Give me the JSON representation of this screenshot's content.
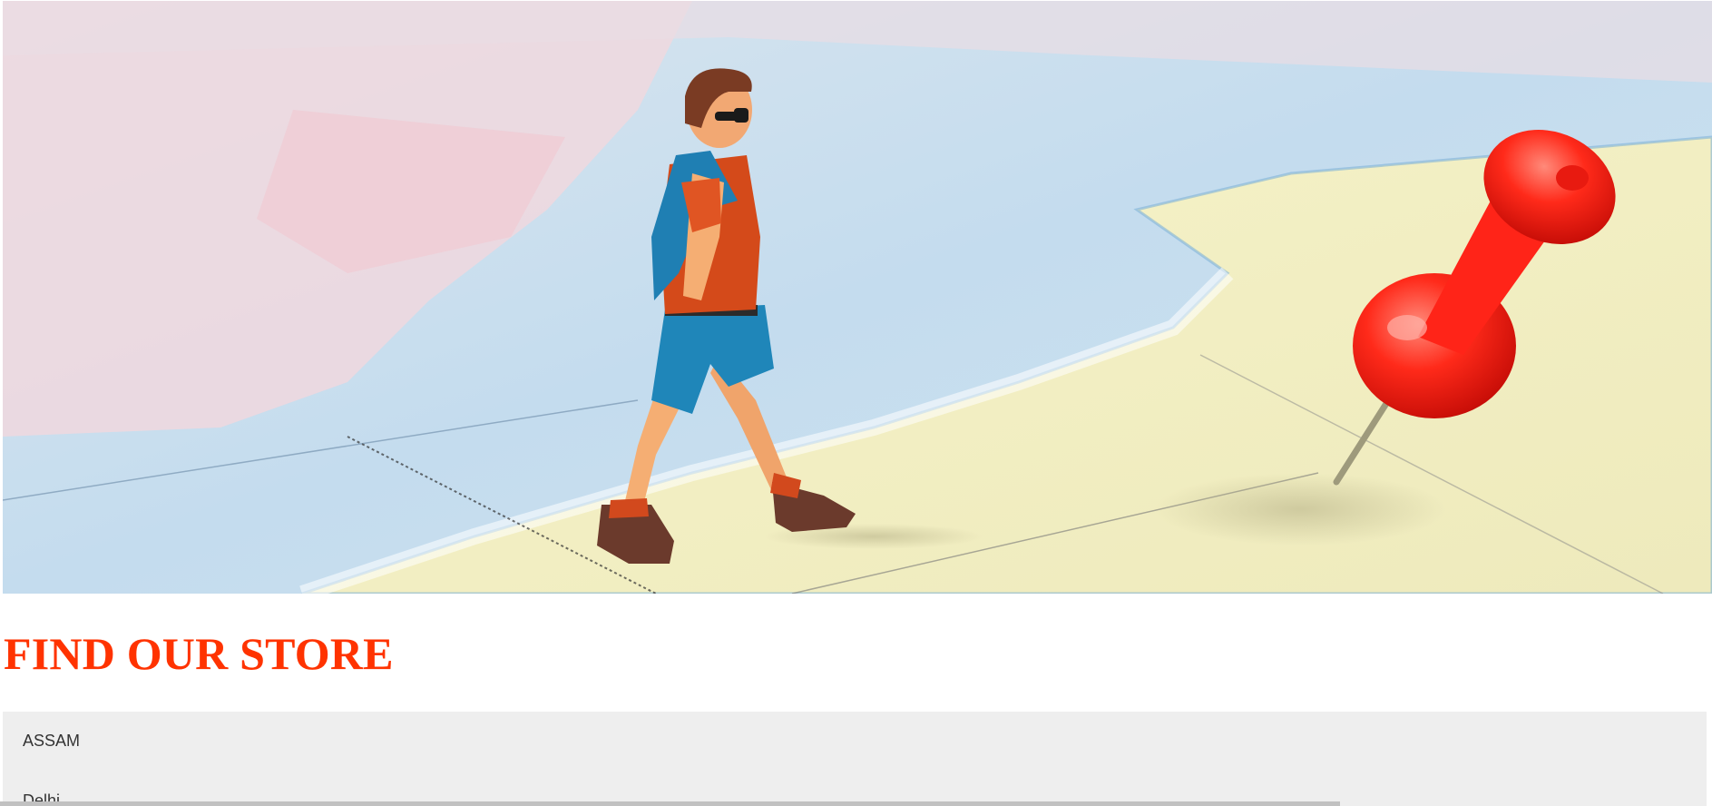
{
  "hero": {
    "image": "traveler-figurine-walking-toward-red-map-pin",
    "colors": {
      "map_blue": "#cfe3f1",
      "map_pink": "#f2d6dd",
      "map_yellow": "#f4f0c3",
      "pin_red": "#ff1d12",
      "shirt_orange": "#d84c1c",
      "shorts_blue": "#1e86b8"
    }
  },
  "page": {
    "title": "FIND OUR STORE",
    "title_color": "#ff3300"
  },
  "stores": {
    "panel_color": "#eeeeee",
    "items": [
      {
        "label": "ASSAM"
      },
      {
        "label": "Delhi"
      }
    ]
  }
}
